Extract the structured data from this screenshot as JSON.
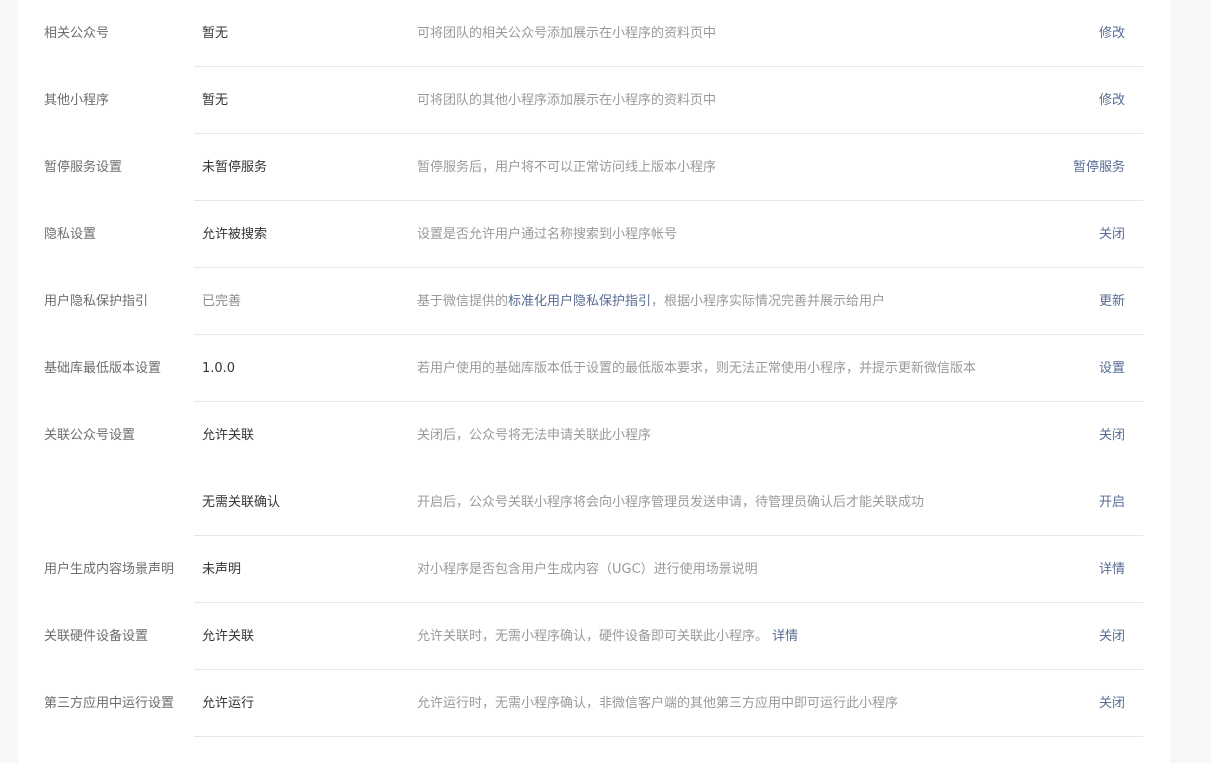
{
  "settings": {
    "rows": [
      {
        "label": "相关公众号",
        "value": "暂无",
        "desc": "可将团队的相关公众号添加展示在小程序的资料页中",
        "action": "修改"
      },
      {
        "label": "其他小程序",
        "value": "暂无",
        "desc": "可将团队的其他小程序添加展示在小程序的资料页中",
        "action": "修改"
      },
      {
        "label": "暂停服务设置",
        "value": "未暂停服务",
        "desc": "暂停服务后，用户将不可以正常访问线上版本小程序",
        "action": "暂停服务"
      },
      {
        "label": "隐私设置",
        "value": "允许被搜索",
        "desc": "设置是否允许用户通过名称搜索到小程序帐号",
        "action": "关闭"
      },
      {
        "label": "用户隐私保护指引",
        "value": "已完善",
        "desc_pre": "基于微信提供的",
        "desc_link": "标准化用户隐私保护指引",
        "desc_post": "，根据小程序实际情况完善并展示给用户",
        "action": "更新"
      },
      {
        "label": "基础库最低版本设置",
        "value": "1.0.0",
        "desc": "若用户使用的基础库版本低于设置的最低版本要求，则无法正常使用小程序，并提示更新微信版本",
        "action": "设置"
      },
      {
        "label": "关联公众号设置",
        "value": "允许关联",
        "desc": "关闭后，公众号将无法申请关联此小程序",
        "action": "关闭"
      },
      {
        "label": "",
        "value": "无需关联确认",
        "desc": "开启后，公众号关联小程序将会向小程序管理员发送申请，待管理员确认后才能关联成功",
        "action": "开启"
      },
      {
        "label": "用户生成内容场景声明",
        "value": "未声明",
        "desc": "对小程序是否包含用户生成内容（UGC）进行使用场景说明",
        "action": "详情"
      },
      {
        "label": "关联硬件设备设置",
        "value": "允许关联",
        "desc_pre": "允许关联时，无需小程序确认，硬件设备即可关联此小程序。",
        "desc_link": "详情",
        "desc_post": "",
        "action": "关闭"
      },
      {
        "label": "第三方应用中运行设置",
        "value": "允许运行",
        "desc": "允许运行时，无需小程序确认，非微信客户端的其他第三方应用中即可运行此小程序",
        "action": "关闭"
      }
    ]
  }
}
